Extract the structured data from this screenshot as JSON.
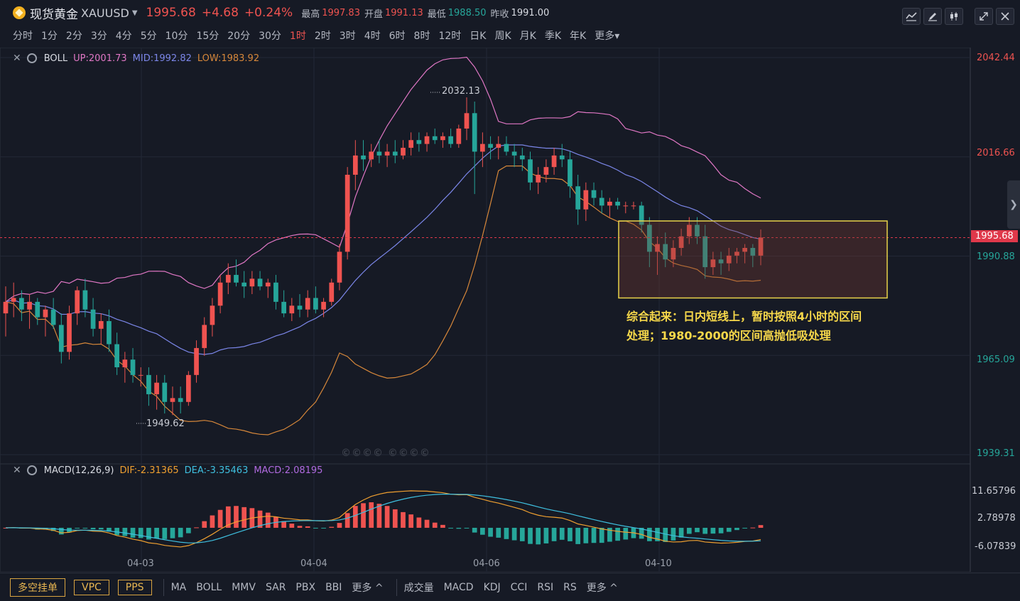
{
  "header": {
    "symbol_name": "现货黄金",
    "symbol_code": "XAUUSD",
    "price": "1995.68",
    "change": "+4.68",
    "change_pct": "+0.24%",
    "high_label": "最高",
    "high": "1997.83",
    "open_label": "开盘",
    "open": "1991.13",
    "low_label": "最低",
    "low": "1988.50",
    "prev_label": "昨收",
    "prev": "1991.00"
  },
  "toolbar_icons": [
    "line-tool-icon",
    "pencil-icon",
    "candle-icon",
    "expand-icon",
    "close-icon"
  ],
  "timeframes": [
    "分时",
    "1分",
    "2分",
    "3分",
    "4分",
    "5分",
    "10分",
    "15分",
    "20分",
    "30分",
    "1时",
    "2时",
    "3时",
    "4时",
    "6时",
    "8时",
    "12时",
    "日K",
    "周K",
    "月K",
    "季K",
    "年K",
    "更多"
  ],
  "active_timeframe": "1时",
  "boll": {
    "name": "BOLL",
    "up": "UP:2001.73",
    "mid": "MID:1992.82",
    "low": "LOW:1983.92"
  },
  "macd": {
    "name": "MACD(12,26,9)",
    "dif": "DIF:-2.31365",
    "dea": "DEA:-3.35463",
    "macd": "MACD:2.08195"
  },
  "price_axis": [
    "2042.44",
    "2016.66",
    "1990.88",
    "1965.09",
    "1939.31"
  ],
  "current_price_tag": "1995.68",
  "macd_axis": [
    "11.65796",
    "2.78978",
    "-6.07839"
  ],
  "high_marker": "2032.13",
  "low_marker": "1949.62",
  "dates": [
    "04-03",
    "04-04",
    "04-06",
    "04-10"
  ],
  "annotation": {
    "line1": "综合起来：日内短线上，暂时按照4小时的区间",
    "line2": "处理；1980-2000的区间高抛低吸处理"
  },
  "watermark": "©©©© ©©©©",
  "bottom": {
    "buttons": [
      "多空挂单",
      "VPC",
      "PPS"
    ],
    "main_indicators": [
      "MA",
      "BOLL",
      "MMV",
      "SAR",
      "PBX",
      "BBI",
      "更多 ^"
    ],
    "sub_indicators": [
      "成交量",
      "MACD",
      "KDJ",
      "CCI",
      "RSI",
      "RS",
      "更多 ^"
    ]
  },
  "colors": {
    "up": "#ef5350",
    "down": "#26a69a",
    "boll_up": "#e077c5",
    "boll_mid": "#7b86e8",
    "boll_low": "#d6873a",
    "dif": "#f0a030",
    "dea": "#3fc0e0",
    "macd": "#b06ae0",
    "annotation": "#f7d84a"
  },
  "chart_data": {
    "type": "candlestick",
    "symbol": "XAUUSD",
    "interval": "1时",
    "y_range": [
      1939.31,
      2042.44
    ],
    "candles": [
      {
        "o": 1976,
        "h": 1983,
        "l": 1970,
        "c": 1979
      },
      {
        "o": 1979,
        "h": 1984,
        "l": 1975,
        "c": 1980
      },
      {
        "o": 1980,
        "h": 1982,
        "l": 1974,
        "c": 1977
      },
      {
        "o": 1977,
        "h": 1981,
        "l": 1972,
        "c": 1979
      },
      {
        "o": 1979,
        "h": 1980,
        "l": 1973,
        "c": 1975
      },
      {
        "o": 1975,
        "h": 1978,
        "l": 1970,
        "c": 1977
      },
      {
        "o": 1977,
        "h": 1980,
        "l": 1972,
        "c": 1973
      },
      {
        "o": 1973,
        "h": 1976,
        "l": 1963,
        "c": 1966
      },
      {
        "o": 1966,
        "h": 1978,
        "l": 1964,
        "c": 1976
      },
      {
        "o": 1976,
        "h": 1983,
        "l": 1973,
        "c": 1982
      },
      {
        "o": 1982,
        "h": 1985,
        "l": 1975,
        "c": 1977
      },
      {
        "o": 1977,
        "h": 1980,
        "l": 1970,
        "c": 1972
      },
      {
        "o": 1972,
        "h": 1976,
        "l": 1968,
        "c": 1974
      },
      {
        "o": 1974,
        "h": 1977,
        "l": 1966,
        "c": 1968
      },
      {
        "o": 1968,
        "h": 1971,
        "l": 1960,
        "c": 1962
      },
      {
        "o": 1962,
        "h": 1966,
        "l": 1958,
        "c": 1964
      },
      {
        "o": 1964,
        "h": 1967,
        "l": 1958,
        "c": 1960
      },
      {
        "o": 1960,
        "h": 1962,
        "l": 1957,
        "c": 1960
      },
      {
        "o": 1960,
        "h": 1962,
        "l": 1952,
        "c": 1955
      },
      {
        "o": 1955,
        "h": 1960,
        "l": 1951,
        "c": 1958
      },
      {
        "o": 1958,
        "h": 1960,
        "l": 1950,
        "c": 1953
      },
      {
        "o": 1953,
        "h": 1957,
        "l": 1949.6,
        "c": 1954
      },
      {
        "o": 1954,
        "h": 1957,
        "l": 1950,
        "c": 1953
      },
      {
        "o": 1953,
        "h": 1961,
        "l": 1952,
        "c": 1960
      },
      {
        "o": 1960,
        "h": 1969,
        "l": 1958,
        "c": 1967
      },
      {
        "o": 1967,
        "h": 1975,
        "l": 1965,
        "c": 1973
      },
      {
        "o": 1973,
        "h": 1980,
        "l": 1970,
        "c": 1978
      },
      {
        "o": 1978,
        "h": 1986,
        "l": 1976,
        "c": 1984
      },
      {
        "o": 1984,
        "h": 1989,
        "l": 1981,
        "c": 1986
      },
      {
        "o": 1986,
        "h": 1990,
        "l": 1983,
        "c": 1984
      },
      {
        "o": 1984,
        "h": 1987,
        "l": 1980,
        "c": 1983
      },
      {
        "o": 1983,
        "h": 1987,
        "l": 1981,
        "c": 1985
      },
      {
        "o": 1985,
        "h": 1987,
        "l": 1982,
        "c": 1983
      },
      {
        "o": 1983,
        "h": 1985,
        "l": 1980,
        "c": 1984
      },
      {
        "o": 1984,
        "h": 1986,
        "l": 1977,
        "c": 1979
      },
      {
        "o": 1979,
        "h": 1982,
        "l": 1975,
        "c": 1976
      },
      {
        "o": 1976,
        "h": 1980,
        "l": 1974,
        "c": 1978
      },
      {
        "o": 1978,
        "h": 1981,
        "l": 1975,
        "c": 1977
      },
      {
        "o": 1977,
        "h": 1982,
        "l": 1975,
        "c": 1980
      },
      {
        "o": 1980,
        "h": 1983,
        "l": 1976,
        "c": 1977
      },
      {
        "o": 1977,
        "h": 1980,
        "l": 1975,
        "c": 1979
      },
      {
        "o": 1979,
        "h": 1985,
        "l": 1978,
        "c": 1984
      },
      {
        "o": 1984,
        "h": 1994,
        "l": 1982,
        "c": 1992
      },
      {
        "o": 1992,
        "h": 2014,
        "l": 1990,
        "c": 2012
      },
      {
        "o": 2012,
        "h": 2021,
        "l": 2008,
        "c": 2017
      },
      {
        "o": 2017,
        "h": 2021,
        "l": 2013,
        "c": 2016
      },
      {
        "o": 2016,
        "h": 2020,
        "l": 2014,
        "c": 2018
      },
      {
        "o": 2018,
        "h": 2021,
        "l": 2015,
        "c": 2017
      },
      {
        "o": 2017,
        "h": 2020,
        "l": 2014,
        "c": 2018
      },
      {
        "o": 2018,
        "h": 2021,
        "l": 2015,
        "c": 2017
      },
      {
        "o": 2017,
        "h": 2021,
        "l": 2016,
        "c": 2019
      },
      {
        "o": 2019,
        "h": 2023,
        "l": 2017,
        "c": 2021
      },
      {
        "o": 2021,
        "h": 2023,
        "l": 2018,
        "c": 2020
      },
      {
        "o": 2020,
        "h": 2023,
        "l": 2018,
        "c": 2022
      },
      {
        "o": 2022,
        "h": 2024,
        "l": 2020,
        "c": 2021
      },
      {
        "o": 2021,
        "h": 2023,
        "l": 2019,
        "c": 2022
      },
      {
        "o": 2022,
        "h": 2024,
        "l": 2019,
        "c": 2020
      },
      {
        "o": 2020,
        "h": 2025,
        "l": 2019,
        "c": 2024
      },
      {
        "o": 2024,
        "h": 2032.1,
        "l": 2021,
        "c": 2028
      },
      {
        "o": 2028,
        "h": 2031,
        "l": 2007,
        "c": 2018
      },
      {
        "o": 2018,
        "h": 2023,
        "l": 2014,
        "c": 2020
      },
      {
        "o": 2020,
        "h": 2022,
        "l": 2016,
        "c": 2019
      },
      {
        "o": 2019,
        "h": 2022,
        "l": 2016,
        "c": 2020
      },
      {
        "o": 2020,
        "h": 2022,
        "l": 2017,
        "c": 2018
      },
      {
        "o": 2018,
        "h": 2020,
        "l": 2014,
        "c": 2017
      },
      {
        "o": 2017,
        "h": 2019,
        "l": 2013,
        "c": 2016
      },
      {
        "o": 2016,
        "h": 2018,
        "l": 2008,
        "c": 2010
      },
      {
        "o": 2010,
        "h": 2014,
        "l": 2007,
        "c": 2012
      },
      {
        "o": 2012,
        "h": 2016,
        "l": 2010,
        "c": 2014
      },
      {
        "o": 2014,
        "h": 2019,
        "l": 2012,
        "c": 2017
      },
      {
        "o": 2017,
        "h": 2020,
        "l": 2014,
        "c": 2016
      },
      {
        "o": 2016,
        "h": 2018,
        "l": 2006,
        "c": 2009
      },
      {
        "o": 2009,
        "h": 2012,
        "l": 1999,
        "c": 2003
      },
      {
        "o": 2003,
        "h": 2010,
        "l": 2000,
        "c": 2008
      },
      {
        "o": 2008,
        "h": 2010,
        "l": 2004,
        "c": 2006
      },
      {
        "o": 2006,
        "h": 2008,
        "l": 2002,
        "c": 2004
      },
      {
        "o": 2004,
        "h": 2006,
        "l": 2001,
        "c": 2005
      },
      {
        "o": 2005,
        "h": 2006,
        "l": 2003,
        "c": 2004
      },
      {
        "o": 2004,
        "h": 2005,
        "l": 2002,
        "c": 2004
      },
      {
        "o": 2004,
        "h": 2005,
        "l": 2003,
        "c": 2004
      },
      {
        "o": 2004,
        "h": 2005,
        "l": 1997,
        "c": 1999
      },
      {
        "o": 1999,
        "h": 2001,
        "l": 1988,
        "c": 1992
      },
      {
        "o": 1992,
        "h": 1996,
        "l": 1986,
        "c": 1994
      },
      {
        "o": 1994,
        "h": 1997,
        "l": 1988,
        "c": 1990
      },
      {
        "o": 1990,
        "h": 1995,
        "l": 1988,
        "c": 1993
      },
      {
        "o": 1993,
        "h": 1998,
        "l": 1991,
        "c": 1996
      },
      {
        "o": 1996,
        "h": 2001,
        "l": 1994,
        "c": 1999
      },
      {
        "o": 1999,
        "h": 2001,
        "l": 1994,
        "c": 1996
      },
      {
        "o": 1996,
        "h": 1999,
        "l": 1985,
        "c": 1988
      },
      {
        "o": 1988,
        "h": 1992,
        "l": 1986,
        "c": 1990
      },
      {
        "o": 1990,
        "h": 1992,
        "l": 1986,
        "c": 1989
      },
      {
        "o": 1989,
        "h": 1993,
        "l": 1987,
        "c": 1991
      },
      {
        "o": 1991,
        "h": 1993,
        "l": 1989,
        "c": 1992
      },
      {
        "o": 1992,
        "h": 1994,
        "l": 1989,
        "c": 1993
      },
      {
        "o": 1993,
        "h": 1994,
        "l": 1988,
        "c": 1991
      },
      {
        "o": 1991,
        "h": 1997.8,
        "l": 1988.5,
        "c": 1995.68
      }
    ],
    "bollinger": {
      "up": "UP:2001.73",
      "mid": "MID:1992.82",
      "low": "LOW:1983.92"
    },
    "macd_params": [
      12,
      26,
      9
    ],
    "annotation_box": {
      "price_top": 2000,
      "price_bottom": 1980
    }
  }
}
